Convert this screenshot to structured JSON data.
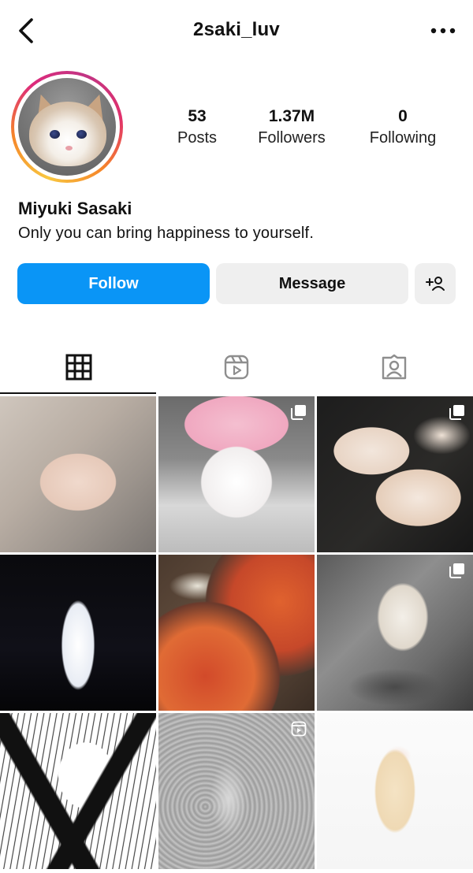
{
  "header": {
    "username": "2saki_luv",
    "back_icon": "chevron-left-icon",
    "more_icon": "more-horizontal-icon"
  },
  "profile": {
    "posts_count": "53",
    "posts_label": "Posts",
    "followers_count": "1.37M",
    "followers_label": "Followers",
    "following_count": "0",
    "following_label": "Following",
    "display_name": "Miyuki Sasaki",
    "bio": "Only you can bring happiness to yourself."
  },
  "actions": {
    "follow_label": "Follow",
    "message_label": "Message",
    "add_user_icon": "add-user-icon"
  },
  "tabs": [
    {
      "name": "grid",
      "icon": "grid-icon",
      "active": true
    },
    {
      "name": "reels",
      "icon": "reels-icon",
      "active": false
    },
    {
      "name": "tagged",
      "icon": "tagged-icon",
      "active": false
    }
  ],
  "colors": {
    "follow_bg": "#0a95f6",
    "secondary_bg": "#efefef",
    "story_ring": [
      "#f8c740",
      "#f58529",
      "#dd2a7b",
      "#c13584"
    ]
  },
  "posts": [
    {
      "subject": "selfie",
      "badge": null
    },
    {
      "subject": "cat-in-pink-hat",
      "badge": "multi-photo-icon"
    },
    {
      "subject": "lilies",
      "badge": "multi-photo-icon"
    },
    {
      "subject": "white-figure",
      "badge": null
    },
    {
      "subject": "ramen-bowls",
      "badge": null
    },
    {
      "subject": "angel-with-candles",
      "badge": "multi-photo-icon"
    },
    {
      "subject": "manga-drawing",
      "badge": null
    },
    {
      "subject": "flowers-bw",
      "badge": "reel-icon"
    },
    {
      "subject": "anime-girl",
      "badge": null
    }
  ]
}
